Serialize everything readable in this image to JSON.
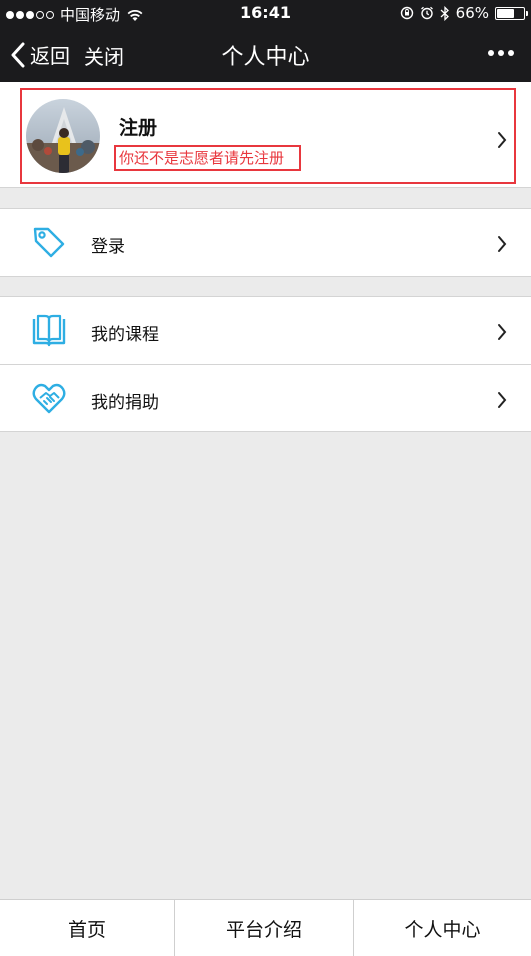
{
  "status_bar": {
    "carrier": "中国移动",
    "time": "16:41",
    "battery": "66%",
    "battery_level": 0.66
  },
  "nav": {
    "back_label": "返回",
    "close_label": "关闭",
    "title": "个人中心"
  },
  "profile": {
    "name": "注册",
    "subtitle": "你还不是志愿者请先注册"
  },
  "menu": {
    "login": {
      "label": "登录",
      "icon": "tag-icon"
    },
    "courses": {
      "label": "我的课程",
      "icon": "book-icon"
    },
    "donations": {
      "label": "我的捐助",
      "icon": "heart-handshake-icon"
    }
  },
  "tabs": [
    {
      "label": "首页"
    },
    {
      "label": "平台介绍"
    },
    {
      "label": "个人中心"
    }
  ],
  "colors": {
    "accent": "#2eaee3",
    "highlight": "#e8373e",
    "bar": "#1b1b1d"
  }
}
